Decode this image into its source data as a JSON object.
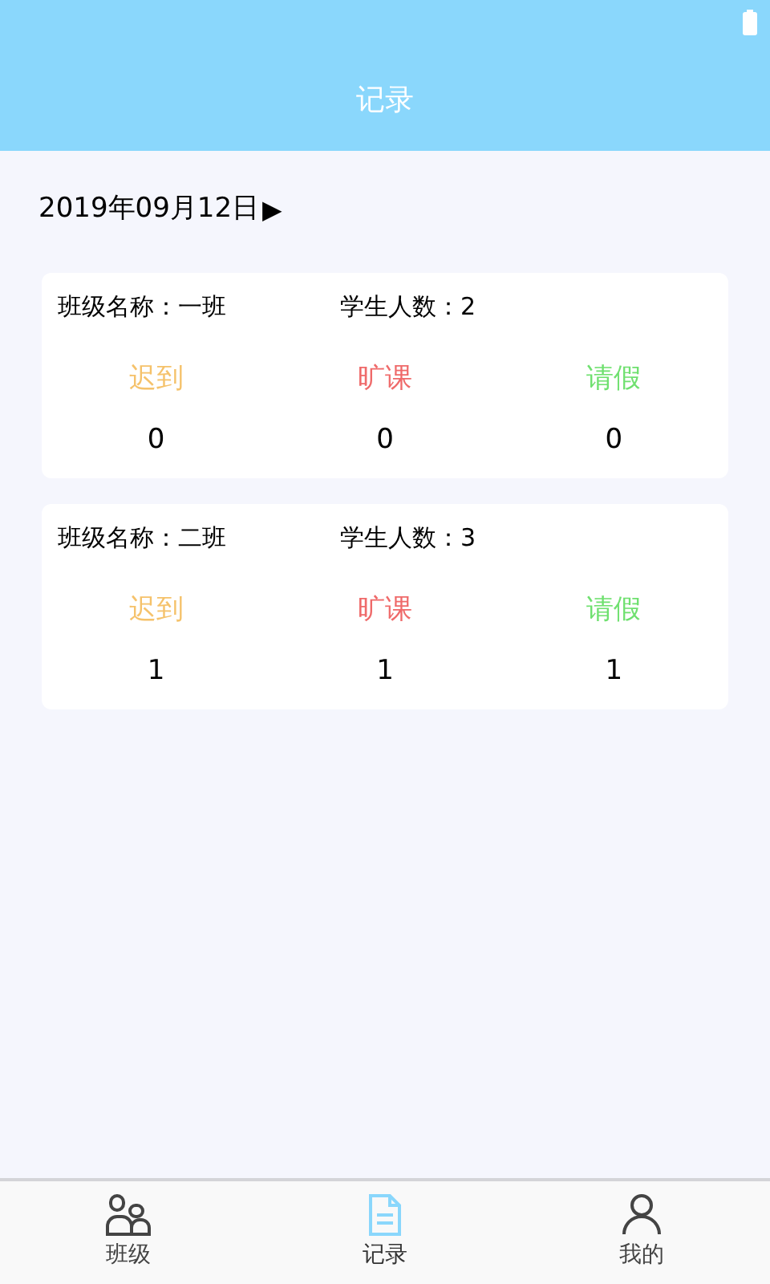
{
  "header": {
    "title": "记录"
  },
  "date": {
    "label": "2019年09月12日",
    "arrow": "▶"
  },
  "classes": [
    {
      "name": "班级名称：一班",
      "students": "学生人数：2",
      "stats": [
        {
          "label": "迟到",
          "value": "0",
          "color": "#f5c26b"
        },
        {
          "label": "旷课",
          "value": "0",
          "color": "#ef6a6a"
        },
        {
          "label": "请假",
          "value": "0",
          "color": "#6fe06f"
        }
      ]
    },
    {
      "name": "班级名称：二班",
      "students": "学生人数：3",
      "stats": [
        {
          "label": "迟到",
          "value": "1",
          "color": "#f5c26b"
        },
        {
          "label": "旷课",
          "value": "1",
          "color": "#ef6a6a"
        },
        {
          "label": "请假",
          "value": "1",
          "color": "#6fe06f"
        }
      ]
    }
  ],
  "tabs": [
    {
      "label": "班级",
      "kind": "people",
      "selected": false
    },
    {
      "label": "记录",
      "kind": "document",
      "selected": true
    },
    {
      "label": "我的",
      "kind": "person",
      "selected": false
    }
  ]
}
